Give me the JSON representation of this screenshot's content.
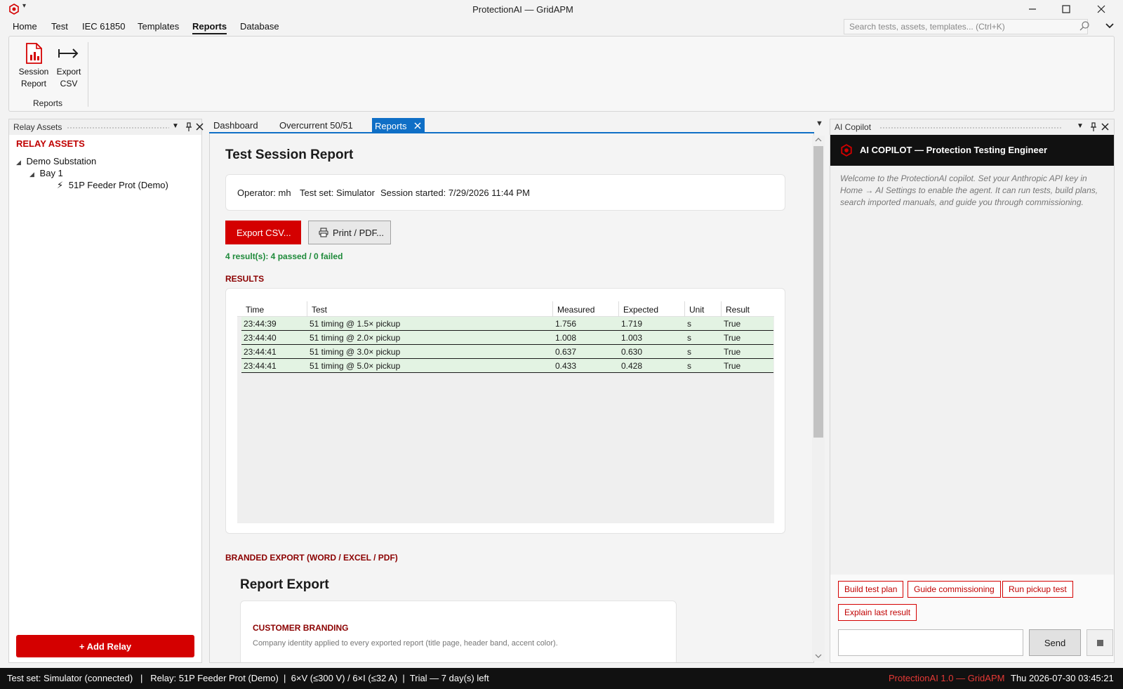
{
  "window": {
    "title": "ProtectionAI — GridAPM"
  },
  "menu": {
    "items": [
      "Home",
      "Test",
      "IEC 61850",
      "Templates",
      "Reports",
      "Database"
    ],
    "active": "Reports"
  },
  "search": {
    "placeholder": "Search tests, assets, templates... (Ctrl+K)"
  },
  "ribbon": {
    "buttons": [
      {
        "line1": "Session",
        "line2": "Report",
        "icon": "session-report-icon"
      },
      {
        "line1": "Export",
        "line2": "CSV",
        "icon": "export-arrow-icon"
      }
    ],
    "group_label": "Reports"
  },
  "left_panel": {
    "title": "Relay Assets",
    "section": "RELAY ASSETS",
    "tree": {
      "substation": "Demo Substation",
      "bay": "Bay 1",
      "relay": "51P Feeder Prot (Demo)"
    },
    "add_button": "+ Add Relay"
  },
  "tabs": {
    "items": [
      "Dashboard",
      "Overcurrent 50/51",
      "Reports"
    ],
    "active": "Reports"
  },
  "report": {
    "heading": "Test Session Report",
    "operator": "Operator: mh",
    "test_set": "Test set: Simulator",
    "session_started": "Session started: 7/29/2026 11:44 PM",
    "export_button": "Export CSV...",
    "print_button": "Print / PDF...",
    "summary": "4 result(s): 4 passed / 0 failed",
    "results_label": "RESULTS",
    "columns": [
      "Time",
      "Test",
      "Measured",
      "Expected",
      "Unit",
      "Result"
    ],
    "rows": [
      [
        "23:44:39",
        "51 timing @ 1.5× pickup",
        "1.756",
        "1.719",
        "s",
        "True"
      ],
      [
        "23:44:40",
        "51 timing @ 2.0× pickup",
        "1.008",
        "1.003",
        "s",
        "True"
      ],
      [
        "23:44:41",
        "51 timing @ 3.0× pickup",
        "0.637",
        "0.630",
        "s",
        "True"
      ],
      [
        "23:44:41",
        "51 timing @ 5.0× pickup",
        "0.433",
        "0.428",
        "s",
        "True"
      ]
    ],
    "branded_label": "BRANDED EXPORT (WORD / EXCEL / PDF)",
    "export_heading": "Report Export",
    "branding_label": "CUSTOMER BRANDING",
    "branding_desc": "Company identity applied to every exported report (title page, header band, accent color)."
  },
  "copilot": {
    "panel_title": "AI Copilot",
    "banner": "AI COPILOT — Protection Testing Engineer",
    "welcome": "Welcome to the ProtectionAI copilot. Set your Anthropic API key in Home → AI Settings to enable the agent. It can run tests, build plans, search imported manuals, and guide you through commissioning.",
    "chips": [
      "Build test plan",
      "Guide commissioning",
      "Run pickup test",
      "Explain last result"
    ],
    "send": "Send"
  },
  "status": {
    "left": "Test set: Simulator (connected)   |   Relay: 51P Feeder Prot (Demo)  |  6×V (≤300 V) / 6×I (≤32 A)  |  Trial — 7 day(s) left",
    "product": "ProtectionAI 1.0 — GridAPM",
    "clock": "Thu 2026-07-30 03:45:21"
  },
  "colors": {
    "accent_red": "#d40000",
    "tab_blue": "#0f6fc6",
    "pass_green": "#1e8a3a",
    "row_green": "#e3f3e3"
  }
}
